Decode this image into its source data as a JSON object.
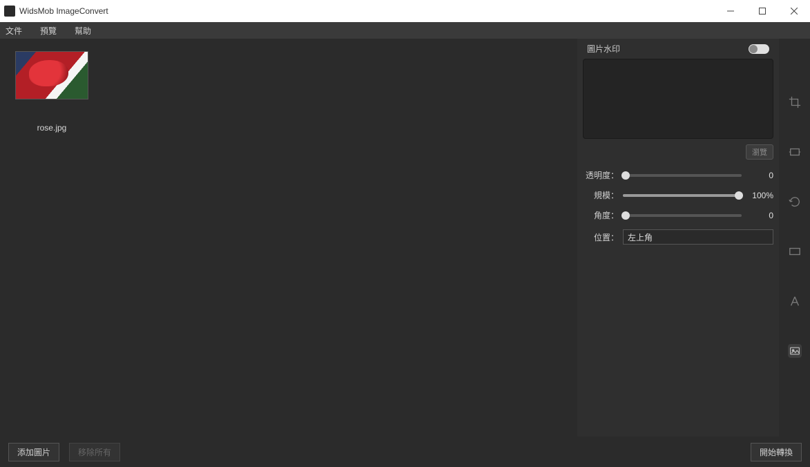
{
  "titlebar": {
    "title": "WidsMob ImageConvert"
  },
  "menu": {
    "file": "文件",
    "edit": "預覽",
    "help": "幫助"
  },
  "thumbnail": {
    "name": "rose.jpg"
  },
  "panel": {
    "title": "圖片水印",
    "browse": "瀏覽",
    "opacity_label": "透明度：",
    "opacity_value": "0",
    "scale_label": "規模：",
    "scale_value": "100%",
    "angle_label": "角度：",
    "angle_value": "0",
    "position_label": "位置：",
    "position_value": "左上角"
  },
  "bottom": {
    "add": "添加圖片",
    "remove": "移除所有",
    "convert": "開始轉換"
  },
  "tool_icons": {
    "crop": "crop-icon",
    "resize": "resize-icon",
    "rotate": "rotate-icon",
    "border": "border-icon",
    "text": "text-icon",
    "watermark": "watermark-icon"
  }
}
